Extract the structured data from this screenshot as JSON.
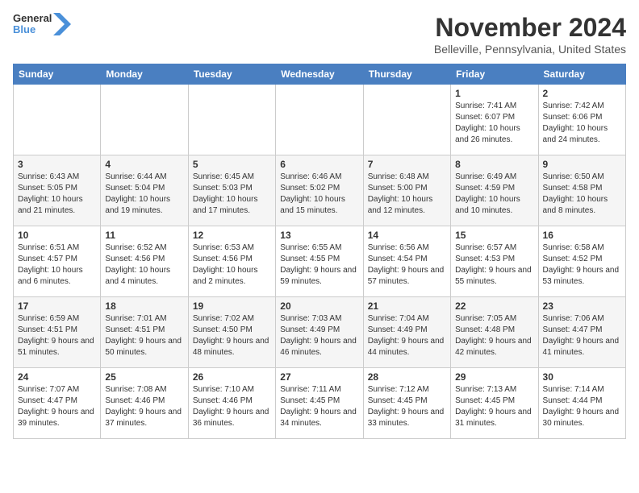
{
  "logo": {
    "general": "General",
    "blue": "Blue"
  },
  "header": {
    "month": "November 2024",
    "location": "Belleville, Pennsylvania, United States"
  },
  "weekdays": [
    "Sunday",
    "Monday",
    "Tuesday",
    "Wednesday",
    "Thursday",
    "Friday",
    "Saturday"
  ],
  "weeks": [
    [
      {
        "day": "",
        "info": ""
      },
      {
        "day": "",
        "info": ""
      },
      {
        "day": "",
        "info": ""
      },
      {
        "day": "",
        "info": ""
      },
      {
        "day": "",
        "info": ""
      },
      {
        "day": "1",
        "info": "Sunrise: 7:41 AM\nSunset: 6:07 PM\nDaylight: 10 hours\nand 26 minutes."
      },
      {
        "day": "2",
        "info": "Sunrise: 7:42 AM\nSunset: 6:06 PM\nDaylight: 10 hours\nand 24 minutes."
      }
    ],
    [
      {
        "day": "3",
        "info": "Sunrise: 6:43 AM\nSunset: 5:05 PM\nDaylight: 10 hours\nand 21 minutes."
      },
      {
        "day": "4",
        "info": "Sunrise: 6:44 AM\nSunset: 5:04 PM\nDaylight: 10 hours\nand 19 minutes."
      },
      {
        "day": "5",
        "info": "Sunrise: 6:45 AM\nSunset: 5:03 PM\nDaylight: 10 hours\nand 17 minutes."
      },
      {
        "day": "6",
        "info": "Sunrise: 6:46 AM\nSunset: 5:02 PM\nDaylight: 10 hours\nand 15 minutes."
      },
      {
        "day": "7",
        "info": "Sunrise: 6:48 AM\nSunset: 5:00 PM\nDaylight: 10 hours\nand 12 minutes."
      },
      {
        "day": "8",
        "info": "Sunrise: 6:49 AM\nSunset: 4:59 PM\nDaylight: 10 hours\nand 10 minutes."
      },
      {
        "day": "9",
        "info": "Sunrise: 6:50 AM\nSunset: 4:58 PM\nDaylight: 10 hours\nand 8 minutes."
      }
    ],
    [
      {
        "day": "10",
        "info": "Sunrise: 6:51 AM\nSunset: 4:57 PM\nDaylight: 10 hours\nand 6 minutes."
      },
      {
        "day": "11",
        "info": "Sunrise: 6:52 AM\nSunset: 4:56 PM\nDaylight: 10 hours\nand 4 minutes."
      },
      {
        "day": "12",
        "info": "Sunrise: 6:53 AM\nSunset: 4:56 PM\nDaylight: 10 hours\nand 2 minutes."
      },
      {
        "day": "13",
        "info": "Sunrise: 6:55 AM\nSunset: 4:55 PM\nDaylight: 9 hours\nand 59 minutes."
      },
      {
        "day": "14",
        "info": "Sunrise: 6:56 AM\nSunset: 4:54 PM\nDaylight: 9 hours\nand 57 minutes."
      },
      {
        "day": "15",
        "info": "Sunrise: 6:57 AM\nSunset: 4:53 PM\nDaylight: 9 hours\nand 55 minutes."
      },
      {
        "day": "16",
        "info": "Sunrise: 6:58 AM\nSunset: 4:52 PM\nDaylight: 9 hours\nand 53 minutes."
      }
    ],
    [
      {
        "day": "17",
        "info": "Sunrise: 6:59 AM\nSunset: 4:51 PM\nDaylight: 9 hours\nand 51 minutes."
      },
      {
        "day": "18",
        "info": "Sunrise: 7:01 AM\nSunset: 4:51 PM\nDaylight: 9 hours\nand 50 minutes."
      },
      {
        "day": "19",
        "info": "Sunrise: 7:02 AM\nSunset: 4:50 PM\nDaylight: 9 hours\nand 48 minutes."
      },
      {
        "day": "20",
        "info": "Sunrise: 7:03 AM\nSunset: 4:49 PM\nDaylight: 9 hours\nand 46 minutes."
      },
      {
        "day": "21",
        "info": "Sunrise: 7:04 AM\nSunset: 4:49 PM\nDaylight: 9 hours\nand 44 minutes."
      },
      {
        "day": "22",
        "info": "Sunrise: 7:05 AM\nSunset: 4:48 PM\nDaylight: 9 hours\nand 42 minutes."
      },
      {
        "day": "23",
        "info": "Sunrise: 7:06 AM\nSunset: 4:47 PM\nDaylight: 9 hours\nand 41 minutes."
      }
    ],
    [
      {
        "day": "24",
        "info": "Sunrise: 7:07 AM\nSunset: 4:47 PM\nDaylight: 9 hours\nand 39 minutes."
      },
      {
        "day": "25",
        "info": "Sunrise: 7:08 AM\nSunset: 4:46 PM\nDaylight: 9 hours\nand 37 minutes."
      },
      {
        "day": "26",
        "info": "Sunrise: 7:10 AM\nSunset: 4:46 PM\nDaylight: 9 hours\nand 36 minutes."
      },
      {
        "day": "27",
        "info": "Sunrise: 7:11 AM\nSunset: 4:45 PM\nDaylight: 9 hours\nand 34 minutes."
      },
      {
        "day": "28",
        "info": "Sunrise: 7:12 AM\nSunset: 4:45 PM\nDaylight: 9 hours\nand 33 minutes."
      },
      {
        "day": "29",
        "info": "Sunrise: 7:13 AM\nSunset: 4:45 PM\nDaylight: 9 hours\nand 31 minutes."
      },
      {
        "day": "30",
        "info": "Sunrise: 7:14 AM\nSunset: 4:44 PM\nDaylight: 9 hours\nand 30 minutes."
      }
    ]
  ]
}
